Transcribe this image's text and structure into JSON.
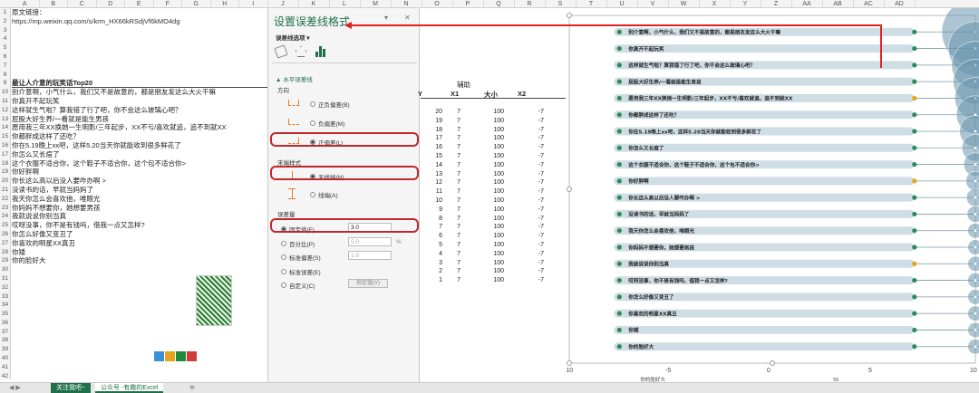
{
  "columns": [
    "A",
    "B",
    "C",
    "D",
    "E",
    "F",
    "G",
    "H",
    "I",
    "J",
    "K",
    "L",
    "M",
    "N",
    "O",
    "P",
    "Q",
    "R",
    "S",
    "T",
    "U",
    "V",
    "W",
    "X",
    "Y",
    "Z",
    "AA",
    "AB",
    "AC",
    "AD"
  ],
  "rows": [
    "1",
    "2",
    "3",
    "4",
    "5",
    "6",
    "7",
    "8",
    "9",
    "10",
    "11",
    "12",
    "13",
    "14",
    "15",
    "16",
    "17",
    "18",
    "19",
    "20",
    "21",
    "22",
    "23",
    "24",
    "25",
    "26",
    "27",
    "28",
    "29",
    "30",
    "31",
    "32",
    "33",
    "34",
    "35",
    "36",
    "37",
    "38",
    "39",
    "40",
    "41",
    "42"
  ],
  "colA": [
    "原文链接：",
    "https://mp.weixin.qq.com/s/krm_HX66kRSdjVf6kMO4dg",
    "",
    "",
    "",
    "",
    "",
    "",
    "最让人介意的玩笑话Top20",
    "别介意啊，小气什么，我们又不是故意的，都是朋友发这么大火干嘛",
    "你真开不起玩笑",
    "这样就生气啦？算我错了行了吧，你不会这么玻璃心吧？",
    "屁股大好生养/一看就是能生男孩",
    "愿用我三年XX换她一生明影/三年起步，XX不亏/喜欢就追，追不到就XX",
    "你都胖成这样了还吃？",
    "你在5.19晚上xx吧，这样5.20当天你就能收到很多鲜花了",
    "你怎么又长痘了",
    "这个衣服不适合你，这个鞋子不适合你，这个包不适合你>",
    "你好胖啊",
    "你长这么高以后没人要咋办啊    >",
    "没读书的话，早就当妈妈了",
    "我天你怎么会喜欢他，唯眼光",
    "你妈妈不想要你，她想要男孩",
    "我就说说你别当真",
    "哎呀没事，你不是有钱吗，借我一点又怎样?",
    "你怎么好像又变丑了",
    "你喜欢的明星XX真丑",
    "你矮",
    "你的脸好大"
  ],
  "pane": {
    "title": "设置误差线格式",
    "options_label": "误差线选项 ▾",
    "section": "▲ 水平误差线",
    "direction_label": "方向",
    "dir_options": [
      "正负偏差(B)",
      "负偏差(M)",
      "正偏差(L)"
    ],
    "endstyle_label": "末端样式",
    "end_options": [
      "无线端(N)",
      "线端(A)"
    ],
    "amount_label": "误差量",
    "amount_options": [
      "固定值(F)",
      "百分比(P)",
      "标准偏差(S)",
      "标准误差(E)",
      "自定义(C)"
    ],
    "fixed_value": "3.0",
    "percent_value": "5.0",
    "percent_unit": "%",
    "stddev_value": "1.0",
    "custom_button": "指定值(V)",
    "pin_icon": "▾",
    "close_icon": "✕"
  },
  "table": {
    "group_header": "辅助",
    "headers": [
      "Y",
      "X1",
      "大小",
      "X2"
    ],
    "rows": [
      [
        "20",
        "7",
        "100",
        "-7"
      ],
      [
        "19",
        "7",
        "100",
        "-7"
      ],
      [
        "18",
        "7",
        "100",
        "-7"
      ],
      [
        "17",
        "7",
        "100",
        "-7"
      ],
      [
        "16",
        "7",
        "100",
        "-7"
      ],
      [
        "15",
        "7",
        "100",
        "-7"
      ],
      [
        "14",
        "7",
        "100",
        "-7"
      ],
      [
        "13",
        "7",
        "100",
        "-7"
      ],
      [
        "12",
        "7",
        "100",
        "-7"
      ],
      [
        "11",
        "7",
        "100",
        "-7"
      ],
      [
        "10",
        "7",
        "100",
        "-7"
      ],
      [
        "9",
        "7",
        "100",
        "-7"
      ],
      [
        "8",
        "7",
        "100",
        "-7"
      ],
      [
        "7",
        "7",
        "100",
        "-7"
      ],
      [
        "6",
        "7",
        "100",
        "-7"
      ],
      [
        "5",
        "7",
        "100",
        "-7"
      ],
      [
        "4",
        "7",
        "100",
        "-7"
      ],
      [
        "3",
        "7",
        "100",
        "-7"
      ],
      [
        "2",
        "7",
        "100",
        "-7"
      ],
      [
        "1",
        "7",
        "100",
        "-7"
      ]
    ]
  },
  "tabs": [
    "关注我吧~",
    "公众号 -有趣的Excel",
    "⊕"
  ],
  "chart_data": {
    "type": "scatter",
    "xlim": [
      -10,
      10
    ],
    "xticks": [
      "-10",
      "-5",
      "0",
      "5",
      "10"
    ],
    "categories": [
      "别介意啊，小气什么，我们又不是故意的，都是朋友发这么大火干嘛",
      "你真开不起玩笑",
      "这样就生气啦？算我错了行了吧，你不会这么玻璃心吧？",
      "屁股大好生养/一看就是能生男孩",
      "愿用我三年XX换她一生明影/三年起步，XX不亏/喜欢就追，追不到就XX",
      "你都胖成这样了还吃？",
      "你在5.19晚上xx吧，这样5.20当天你就能收到很多鲜花了",
      "你怎么又长痘了",
      "这个衣服不适合你，这个鞋子不适合你，这个包不适合你>",
      "你好胖啊",
      "你长这么高以后没人要咋办啊    >",
      "没读书的话，早就当妈妈了",
      "我天你怎么会喜欢他，唯眼光",
      "你妈妈不想要你，她想要男孩",
      "我就说说你别当真",
      "哎呀没事，你不是有钱吗，借我一点又怎样?",
      "你怎么好像又变丑了",
      "你喜欢的明星XX真丑",
      "你矮",
      "你的脸好大"
    ],
    "y": [
      20,
      19,
      18,
      17,
      16,
      15,
      14,
      13,
      12,
      11,
      10,
      9,
      8,
      7,
      6,
      5,
      4,
      3,
      2,
      1
    ],
    "x1": 7,
    "x2": -7,
    "bubble_sizes": [
      100,
      65,
      50,
      44,
      38,
      32,
      22,
      16,
      12,
      8,
      7,
      6,
      5,
      5,
      5,
      5,
      5,
      5,
      5,
      5
    ],
    "bottom_label": "你的脸好大",
    "bottom_value": "55",
    "colors": {
      "bubble": "#6a96ad",
      "bar": "#cfdde5",
      "dot_green": "#2e8b57",
      "dot_orange": "#e8a317",
      "arrow": "#d22"
    }
  }
}
